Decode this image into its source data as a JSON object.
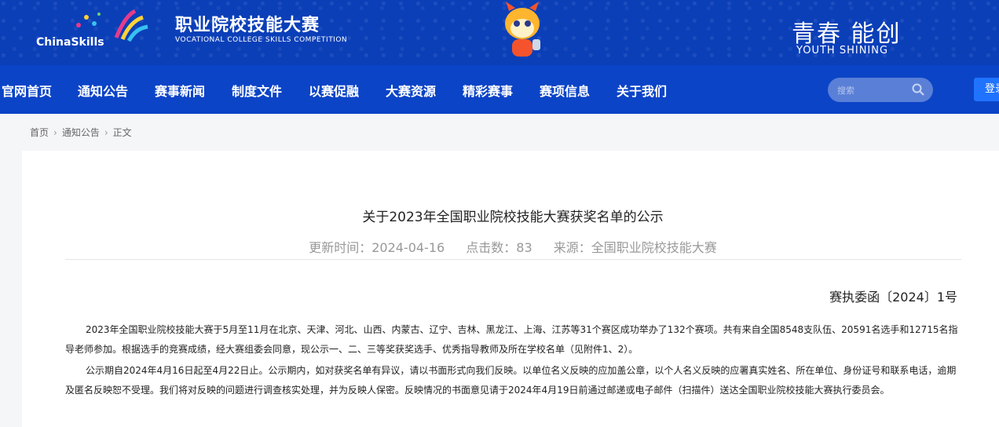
{
  "header": {
    "chinaskills": "ChinaSkills",
    "title_cn": "职业院校技能大赛",
    "title_en": "VOCATIONAL COLLEGE SKILLS COMPETITION",
    "slogan_cn": "青春 能创",
    "slogan_en": "YOUTH SHINING"
  },
  "nav": {
    "items": [
      "官网首页",
      "通知公告",
      "赛事新闻",
      "制度文件",
      "以赛促融",
      "大赛资源",
      "精彩赛事",
      "赛项信息",
      "关于我们"
    ],
    "search_placeholder": "搜索",
    "login": "登录"
  },
  "breadcrumb": [
    "首页",
    "通知公告",
    "正文"
  ],
  "article": {
    "title": "关于2023年全国职业院校技能大赛获奖名单的公示",
    "updated": "更新时间：2024-04-16",
    "clicks": "点击数：83",
    "source": "来源：全国职业院校技能大赛",
    "doc_no": "赛执委函〔2024〕1号",
    "p1": "2023年全国职业院校技能大赛于5月至11月在北京、天津、河北、山西、内蒙古、辽宁、吉林、黑龙江、上海、江苏等31个赛区成功举办了132个赛项。共有来自全国8548支队伍、20591名选手和12715名指导老师参加。根据选手的竞赛成绩，经大赛组委会同意，现公示一、二、三等奖获奖选手、优秀指导教师及所在学校名单（见附件1、2）。",
    "p2": "公示期自2024年4月16日起至4月22日止。公示期内，如对获奖名单有异议，请以书面形式向我们反映。以单位名义反映的应加盖公章，以个人名义反映的应署真实姓名、所在单位、身份证号和联系电话，逾期及匿名反映恕不受理。我们将对反映的问题进行调查核实处理，并为反映人保密。反映情况的书面意见请于2024年4月19日前通过邮递或电子邮件（扫描件）送达全国职业院校技能大赛执行委员会。"
  },
  "colors": {
    "header_bg": "#0b3fb8",
    "nav_bg": "#0c44c7",
    "login_bg": "#1f73ff"
  }
}
